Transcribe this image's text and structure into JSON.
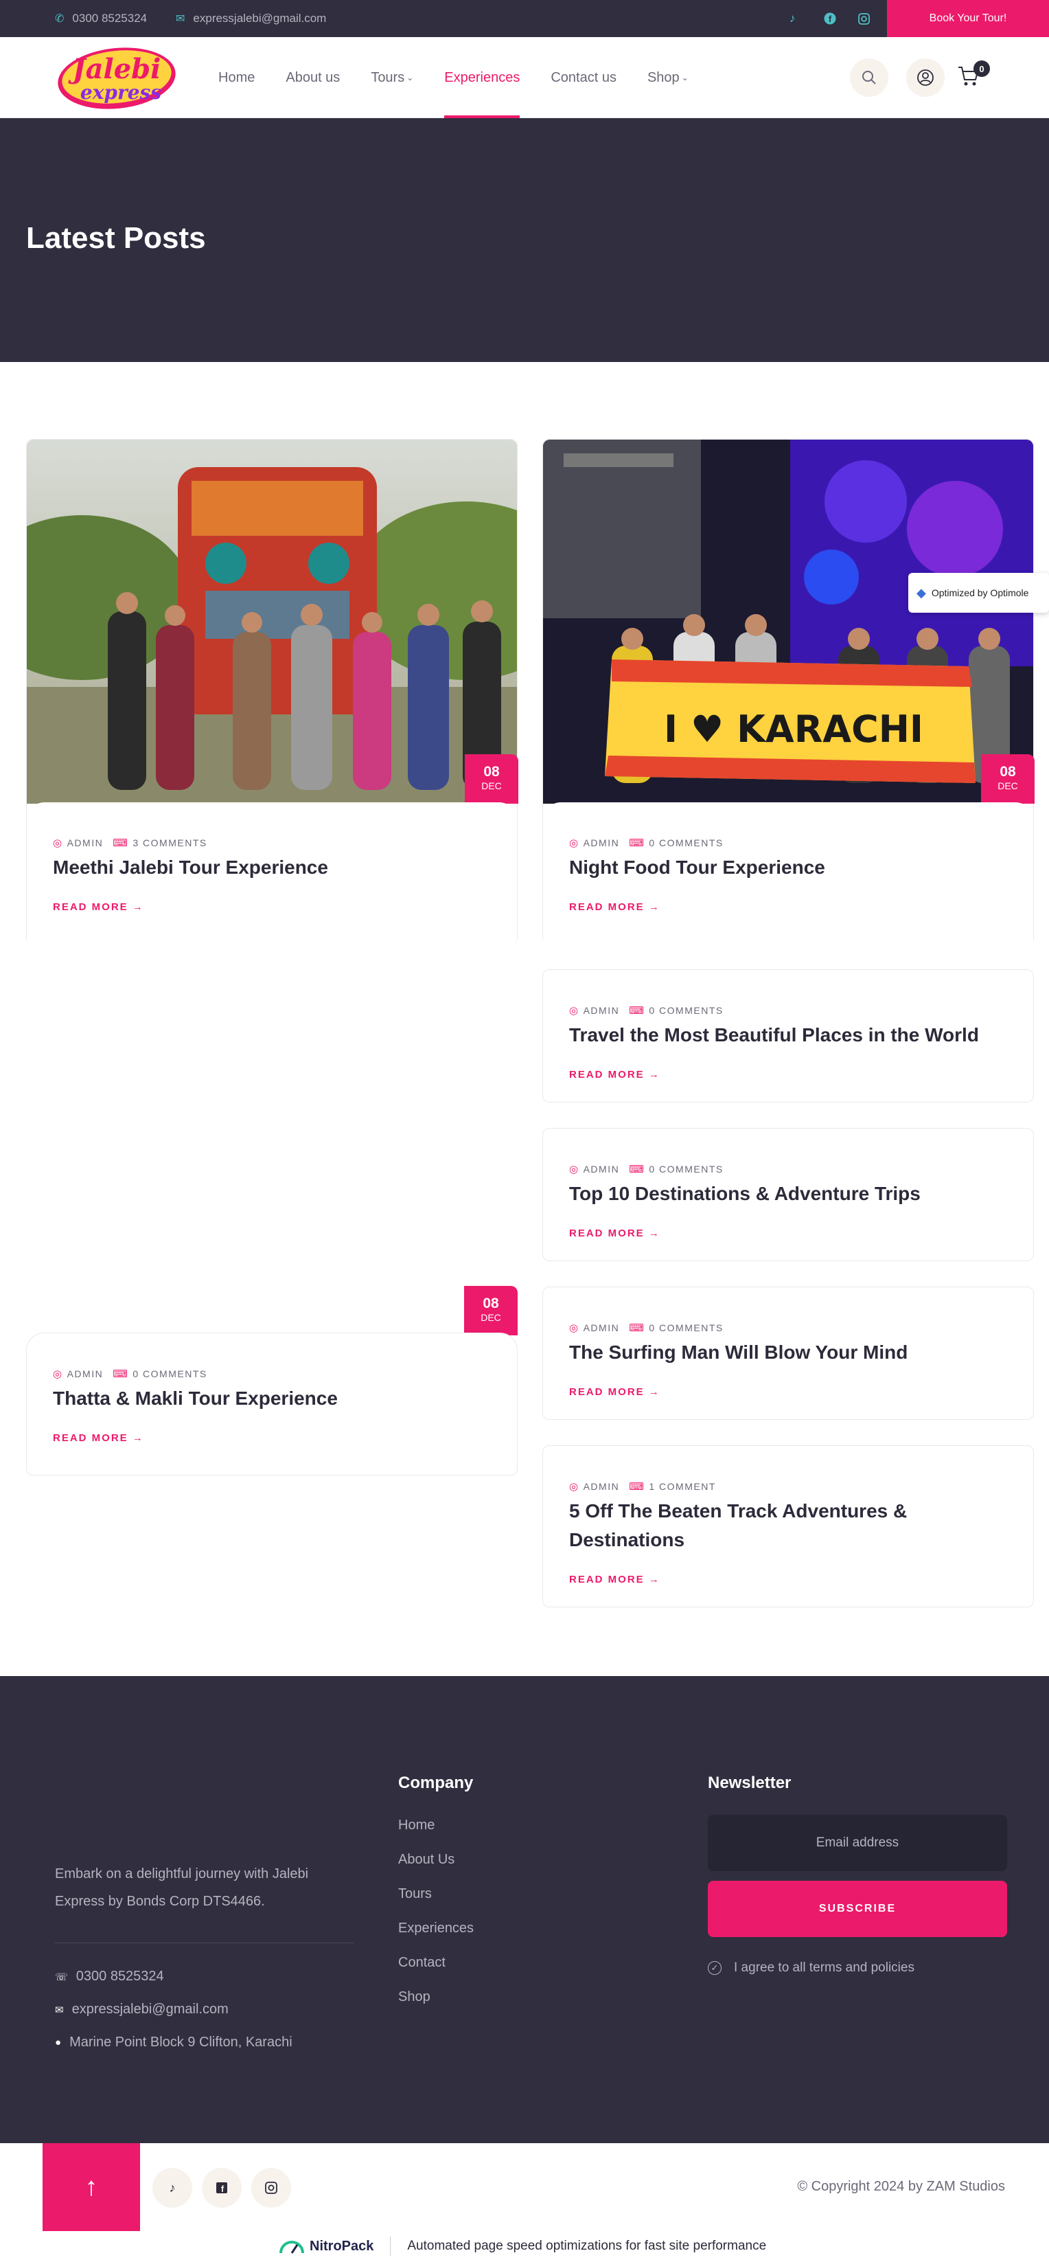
{
  "topbar": {
    "phone": "0300 8525324",
    "email": "expressjalebi@gmail.com",
    "book_button": "Book Your Tour!"
  },
  "nav": {
    "logo_text_1": "Jalebi",
    "logo_text_2": "express",
    "items": [
      {
        "label": "Home"
      },
      {
        "label": "About us"
      },
      {
        "label": "Tours"
      },
      {
        "label": "Experiences"
      },
      {
        "label": "Contact us"
      },
      {
        "label": "Shop"
      }
    ],
    "cart_count": "0"
  },
  "hero": {
    "title": "Latest Posts"
  },
  "posts": [
    {
      "author": "ADMIN",
      "comments": "3 COMMENTS",
      "title": "Meethi Jalebi Tour Experience",
      "read_more": "READ MORE",
      "day": "08",
      "month": "DEC"
    },
    {
      "author": "ADMIN",
      "comments": "0 COMMENTS",
      "title": "Night Food Tour Experience",
      "read_more": "READ MORE",
      "day": "08",
      "month": "DEC"
    },
    {
      "author": "ADMIN",
      "comments": "0 COMMENTS",
      "title": "Travel the Most Beautiful Places in the World",
      "read_more": "READ MORE"
    },
    {
      "author": "ADMIN",
      "comments": "0 COMMENTS",
      "title": "Top 10 Destinations & Adventure Trips",
      "read_more": "READ MORE"
    },
    {
      "author": "ADMIN",
      "comments": "0 COMMENTS",
      "title": "The Surfing Man Will Blow Your Mind",
      "read_more": "READ MORE"
    },
    {
      "author": "ADMIN",
      "comments": "1 COMMENT",
      "title": "5 Off The Beaten Track Adventures & Destinations",
      "read_more": "READ MORE"
    },
    {
      "author": "ADMIN",
      "comments": "0 COMMENTS",
      "title": "Thatta & Makli Tour Experience",
      "read_more": "READ MORE",
      "day": "08",
      "month": "DEC"
    }
  ],
  "banner_text": "I ♥ KARACHI",
  "optimole": "Optimized by Optimole",
  "footer": {
    "about": "Embark on a delightful journey with Jalebi Express by Bonds Corp DTS4466.",
    "phone": "0300 8525324",
    "email": "expressjalebi@gmail.com",
    "address": "Marine Point Block 9 Clifton, Karachi",
    "company_heading": "Company",
    "company_links": [
      "Home",
      "About Us",
      "Tours",
      "Experiences",
      "Contact",
      "Shop"
    ],
    "newsletter_heading": "Newsletter",
    "email_placeholder": "Email address",
    "subscribe": "SUBSCRIBE",
    "agree": "I agree to all terms and policies"
  },
  "bottom": {
    "copyright": "© Copyright 2024 by ZAM Studios",
    "nitro_brand": "NitroPack",
    "nitro_text": "Automated page speed optimizations for fast site performance"
  },
  "colors": {
    "accent": "#ec1a6a",
    "dark": "#302e3f",
    "teal": "#4fc0c5"
  }
}
